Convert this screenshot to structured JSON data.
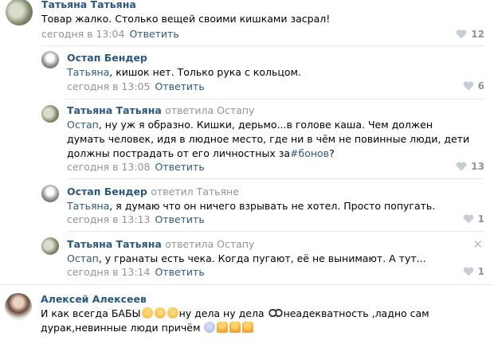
{
  "comments": [
    {
      "author": "Татьяна Татьяна",
      "reply_to": "",
      "mention": "",
      "text": "Товар жалко. Столько вещей своими кишками засрал!",
      "date": "сегодня в 13:04",
      "reply_label": "Ответить",
      "likes": "12",
      "avatar": "tatiana-avatar"
    },
    {
      "author": "Остап Бендер",
      "reply_to": "",
      "mention": "Татьяна",
      "text": ", кишок нет. Только рука с кольцом.",
      "date": "сегодня в 13:05",
      "reply_label": "Ответить",
      "likes": "6",
      "avatar": "ostap-avatar"
    },
    {
      "author": "Татьяна Татьяна",
      "reply_to": "ответила Остапу",
      "mention": "Остап",
      "text": ", ну уж я образно. Кишки, дерьмо...в голове каша. Чем должен думать человек, идя в людное место, где ни в чём не повинные люди, дети должны пострадать от его личностных за",
      "hashtag": "#бонов",
      "text_end": "?",
      "date": "сегодня в 13:08",
      "reply_label": "Ответить",
      "likes": "13",
      "avatar": "tatiana-avatar"
    },
    {
      "author": "Остап Бендер",
      "reply_to": "ответил Татьяне",
      "mention": "Татьяна",
      "text": ", я думаю что он ничего взрывать не хотел. Просто попугать.",
      "date": "сегодня в 13:13",
      "reply_label": "Ответить",
      "likes": "1",
      "avatar": "ostap-avatar"
    },
    {
      "author": "Татьяна Татьяна",
      "reply_to": "ответила Остапу",
      "mention": "Остап",
      "text": ", у гранаты есть чека. Когда пугают, её не вынимают. А тут...",
      "date": "сегодня в 13:14",
      "reply_label": "Ответить",
      "likes": "1",
      "avatar": "tatiana-avatar",
      "close": "✕"
    },
    {
      "author": "Алексей Алексеев",
      "reply_to": "",
      "text_a": "И как всегда БАБЫ",
      "text_b": "ну дела ну дела ",
      "text_c": "неадекватность ,ладно сам дурак,невинные люди причём ",
      "avatar": "aleksey-avatar"
    }
  ],
  "colors": {
    "link": "#2a5885",
    "muted": "#939393",
    "divider": "#e7e8ec",
    "heart": "#c5cdd6"
  }
}
